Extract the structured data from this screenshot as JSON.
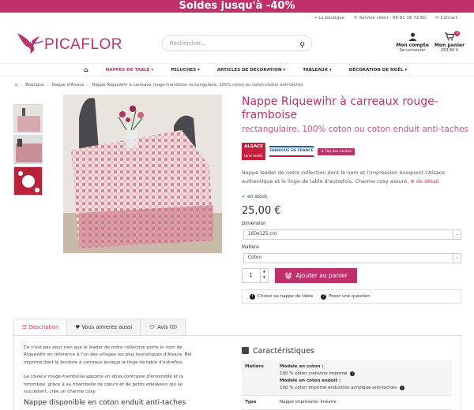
{
  "banner": {
    "text": "Soldes jusqu'à -40%"
  },
  "top_links": {
    "shop": "La boutique",
    "service": "Service client : 06 81 16 72 60",
    "contact": "Contact"
  },
  "logo": {
    "text": "PICAFLOR"
  },
  "search": {
    "placeholder": "Rechercher..."
  },
  "account": {
    "title": "Mon compte",
    "sub": "Se connecter"
  },
  "cart": {
    "title": "Mon panier",
    "amount": "250,60 €",
    "count": "3"
  },
  "nav": {
    "items": [
      {
        "label": "NAPPES DE TABLE",
        "active": true
      },
      {
        "label": "PELUCHES"
      },
      {
        "label": "ARTICLES DE DÉCORATION"
      },
      {
        "label": "TABLEAUX"
      },
      {
        "label": "DÉCORATION DE NOËL"
      }
    ]
  },
  "breadcrumb": [
    "Boutique",
    "Nappe d'Alsace",
    "Nappe Riquewihr à carreaux rouge-framboise rectangulaire, 100% coton ou coton enduit anti-taches"
  ],
  "product": {
    "title": "Nappe Riquewihr à carreaux rouge-framboise",
    "subtitle": "rectangulaire, 100% coton ou coton enduit anti-taches",
    "label_alsace": "ALSACE",
    "label_alsace_sub": "terre textile",
    "label_france": "FABRIQUÉ EN FRANCE",
    "label_top": "Top des ventes",
    "description": "Nappe leader de notre collection dont le nom et l'impression évoquent l'Alsace authentique et le linge de table d'autrefois. Charme cosy assuré.",
    "description_more": "de détail",
    "stock": "en stock",
    "price": "25,00 €",
    "dimension_label": "Dimension",
    "dimension_value": "160x125 cm",
    "material_label": "Matière",
    "material_value": "Coton",
    "quantity": "1",
    "add_to_cart": "Ajouter au panier",
    "help_choose": "Choisir sa nappe de table",
    "help_question": "Poser une question"
  },
  "tabs": [
    {
      "label": "Description",
      "active": true
    },
    {
      "label": "Vous aimerez aussi"
    },
    {
      "label": "Avis (0)"
    }
  ],
  "description_panel": {
    "p1": "Ce n'est pas pour rien que le leader de notre collection porte le nom de Riquewihr en référence à l'un des villages les plus touristiques d'Alsace. Bel imprimé dont le bordure à carreaux évoque le linge de table d'autrefois.",
    "p2": "La couleur rouge-framboise apporte un doux contraste d'ensemble et la retombée, grâce à sa ribambelle de cœurs et de petits édelweiss qui se succèdent, crée un charme cosy.",
    "heading": "Nappe disponible en coton enduit anti-taches"
  },
  "characteristics": {
    "title": "Caractéristiques",
    "rows": [
      {
        "key": "Matière",
        "line1_bold": "Modèle en coton :",
        "line1": "100 % coton cretonne imprimé",
        "line2_bold": "Modèle en coton enduit :",
        "line2": "100 % coton imprimé enduction acrylique anti-taches"
      },
      {
        "key": "Type",
        "value": "Nappe impression linéaire"
      }
    ]
  },
  "colors": {
    "accent": "#c0306a"
  }
}
